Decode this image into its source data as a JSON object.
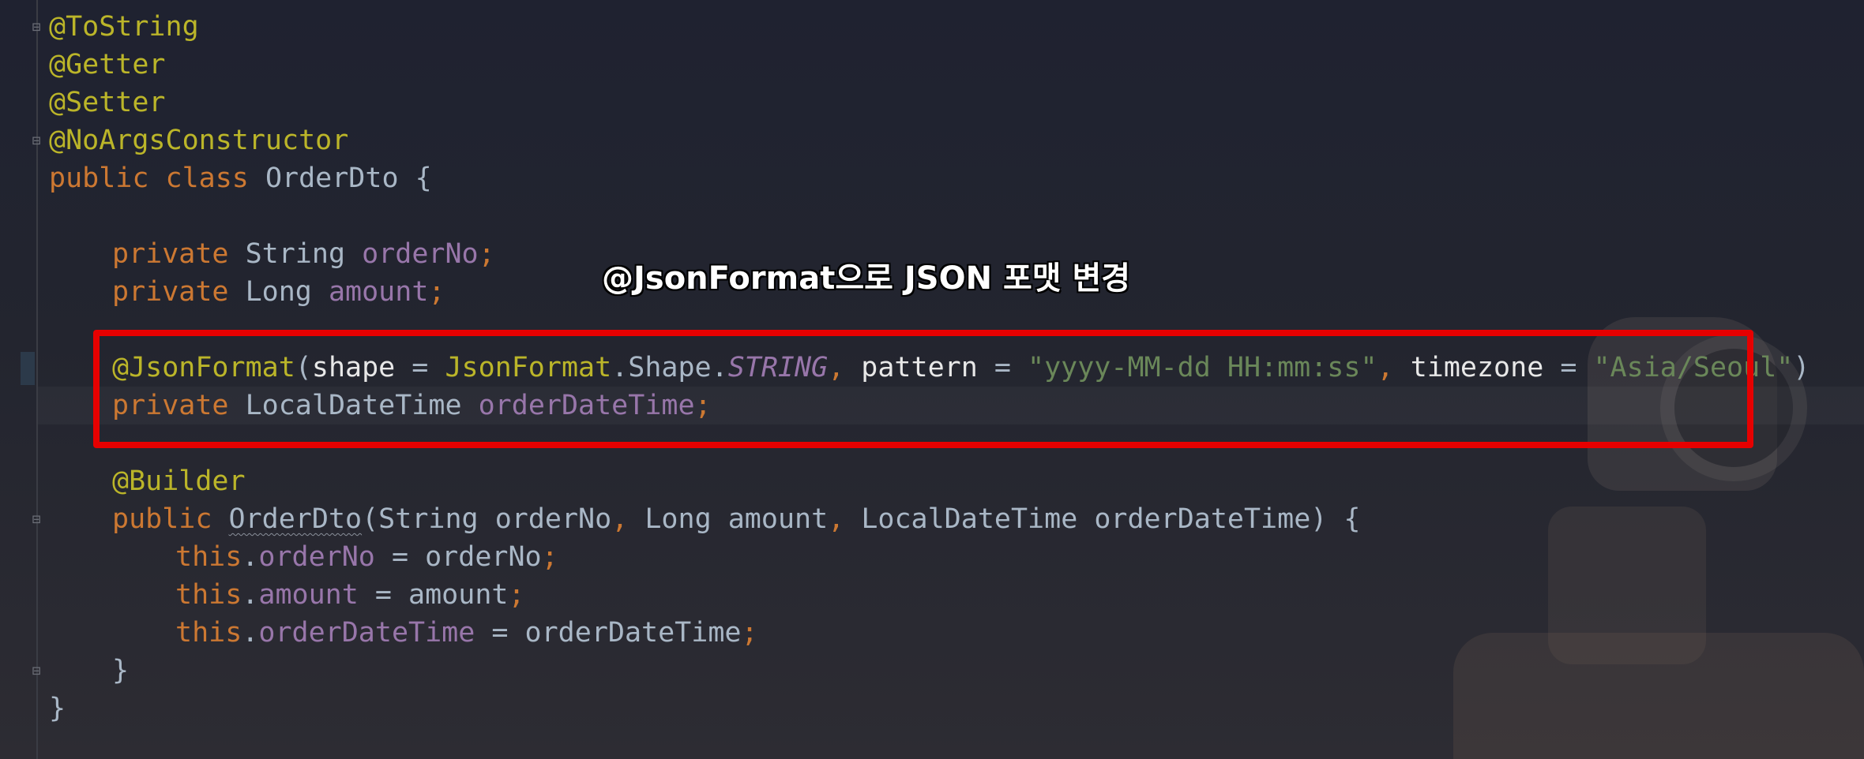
{
  "callout": "@JsonFormat으로 JSON 포맷 변경",
  "code": {
    "ann_tostring": "@ToString",
    "ann_getter": "@Getter",
    "ann_setter": "@Setter",
    "ann_noargs": "@NoArgsConstructor",
    "kw_public": "public",
    "kw_class": "class",
    "kw_private": "private",
    "kw_this": "this",
    "class_name": "OrderDto",
    "type_string": "String",
    "type_long": "Long",
    "type_ldt": "LocalDateTime",
    "field_orderno": "orderNo",
    "field_amount": "amount",
    "field_orderdatetime": "orderDateTime",
    "ann_jsonformat": "@JsonFormat",
    "param_shape": "shape",
    "jsonformat_class": "JsonFormat",
    "shape_cls": ".Shape.",
    "shape_value": "STRING",
    "param_pattern": "pattern",
    "pattern_value": "\"yyyy-MM-dd HH:mm:ss\"",
    "param_timezone": "timezone",
    "timezone_value": "\"Asia/Seoul\"",
    "ann_builder": "@Builder",
    "ctor_name": "OrderDto"
  },
  "colors": {
    "annotation": "#bbb529",
    "keyword": "#cc7832",
    "field": "#9876aa",
    "string": "#6a8759",
    "text": "#a9b7c6",
    "highlight_border": "#e60000"
  }
}
